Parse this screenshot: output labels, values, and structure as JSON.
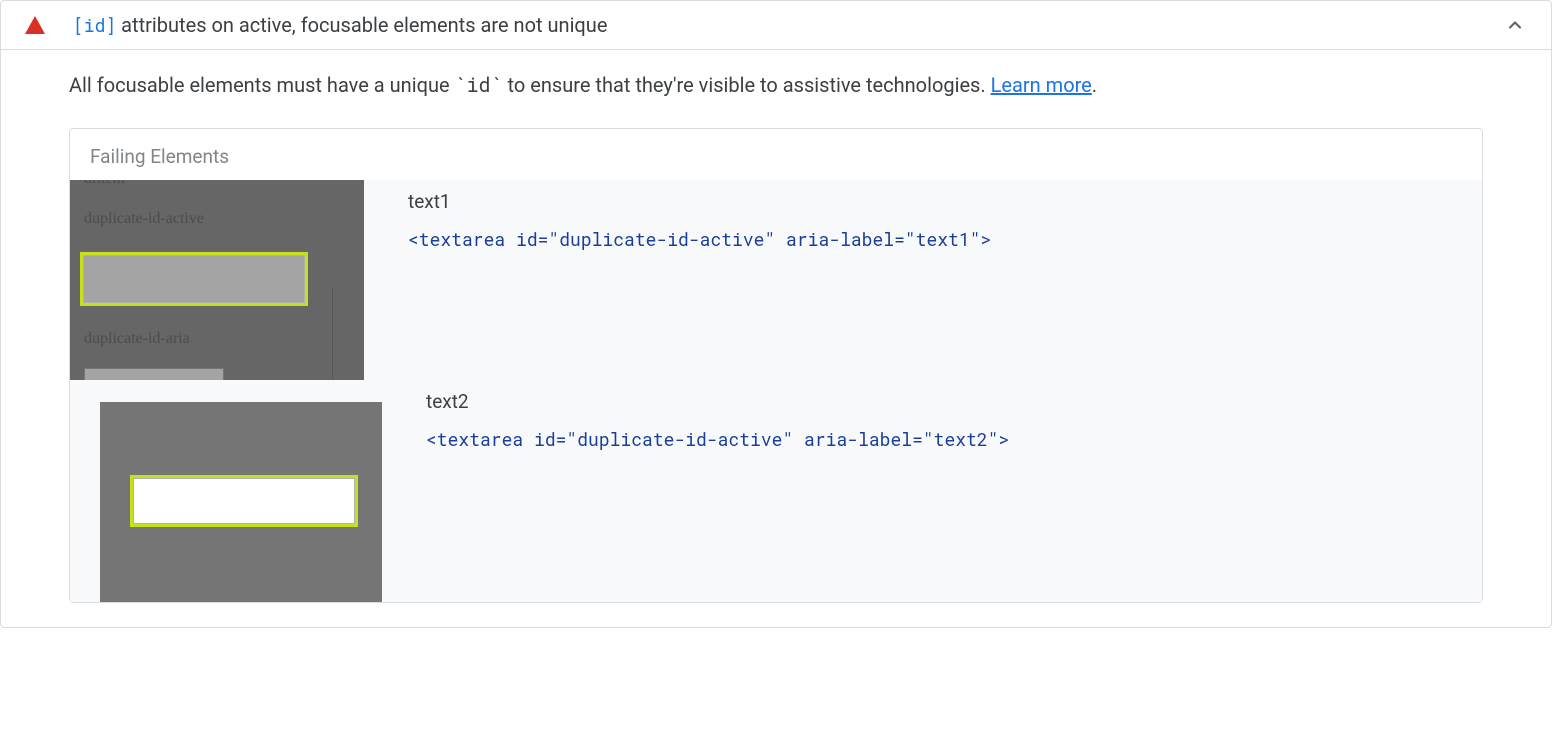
{
  "audit": {
    "severity": "error",
    "title_code": "[id]",
    "title_text": " attributes on active, focusable elements are not unique",
    "description_pre": "All focusable elements must have a unique ",
    "description_code": "`id`",
    "description_post": " to ensure that they're visible to assistive technologies. ",
    "learn_more_label": "Learn more",
    "learn_more_period": "."
  },
  "failing": {
    "header": "Failing Elements",
    "items": [
      {
        "label": "text1",
        "code": "<textarea id=\"duplicate-id-active\" aria-label=\"text1\">",
        "thumb": {
          "cut_text": "dlitem",
          "label1": "duplicate-id-active",
          "label2": "duplicate-id-aria"
        }
      },
      {
        "label": "text2",
        "code": "<textarea id=\"duplicate-id-active\" aria-label=\"text2\">",
        "thumb": {}
      }
    ]
  }
}
